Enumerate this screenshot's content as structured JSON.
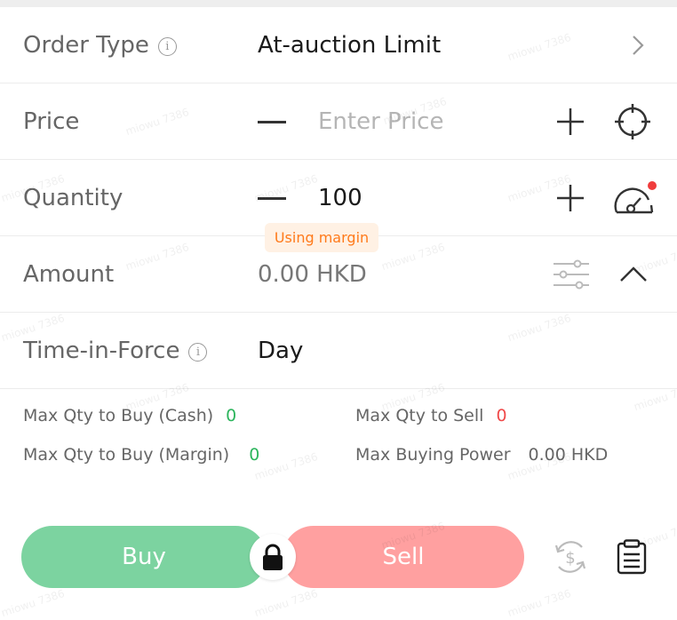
{
  "order_type": {
    "label": "Order Type",
    "value": "At-auction Limit"
  },
  "price": {
    "label": "Price",
    "placeholder": "Enter Price"
  },
  "quantity": {
    "label": "Quantity",
    "value": "100"
  },
  "margin_tag": "Using margin",
  "amount": {
    "label": "Amount",
    "value": "0.00 HKD"
  },
  "time_in_force": {
    "label": "Time-in-Force",
    "value": "Day"
  },
  "stats": {
    "max_qty_buy_cash_label": "Max Qty to Buy (Cash)",
    "max_qty_buy_cash_value": "0",
    "max_qty_sell_label": "Max Qty to Sell",
    "max_qty_sell_value": "0",
    "max_qty_buy_margin_label": "Max Qty to Buy (Margin)",
    "max_qty_buy_margin_value": "0",
    "max_buying_power_label": "Max Buying Power",
    "max_buying_power_value": "0.00 HKD"
  },
  "actions": {
    "buy": "Buy",
    "sell": "Sell"
  },
  "watermark": "miowu 7386",
  "colors": {
    "buy": "#7cd3a0",
    "sell": "#ffa0a0",
    "positive": "#2db55d",
    "negative": "#f04a4a",
    "margin_tag_text": "#ff7a1a",
    "notification_dot": "#f03c3c"
  }
}
